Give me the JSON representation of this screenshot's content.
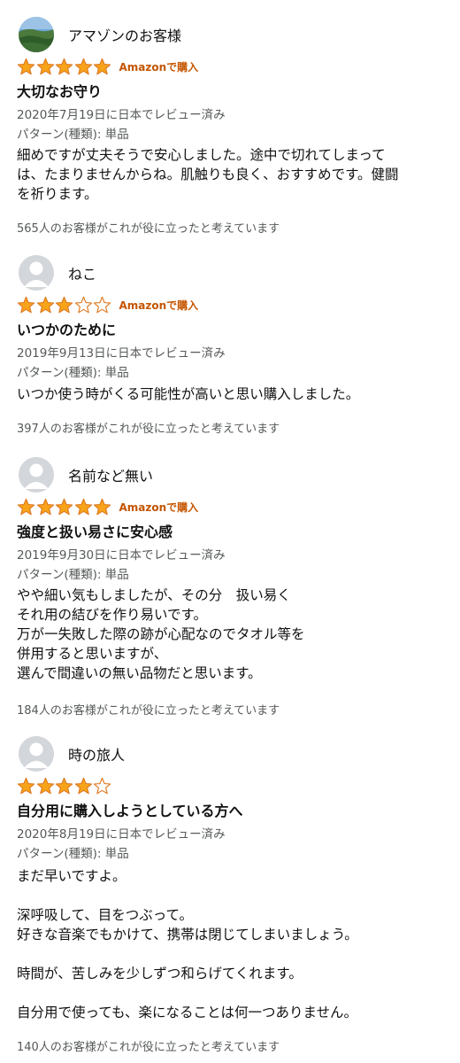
{
  "colors": {
    "star_fill": "#f8a41a",
    "star_outline": "#de7921",
    "badge": "#c45500",
    "meta": "#565959",
    "avatar_bg": "#d3d6da"
  },
  "reviews": [
    {
      "reviewer": "アマゾンのお客様",
      "avatar": "landscape-photo",
      "rating": 5,
      "max_rating": 5,
      "badge": "Amazonで購入",
      "title": "大切なお守り",
      "date_line": "2020年7月19日に日本でレビュー済み",
      "variant": "パターン(種類): 単品",
      "body": "細めですが丈夫そうで安心しました。途中で切れてしまって\nは、たまりませんからね。肌触りも良く、おすすめです。健闘\nを祈ります。",
      "helpful": "565人のお客様がこれが役に立ったと考えています"
    },
    {
      "reviewer": "ねこ",
      "avatar": "default-user",
      "rating": 3,
      "max_rating": 5,
      "badge": "Amazonで購入",
      "title": "いつかのために",
      "date_line": "2019年9月13日に日本でレビュー済み",
      "variant": "パターン(種類): 単品",
      "body": "いつか使う時がくる可能性が高いと思い購入しました。",
      "helpful": "397人のお客様がこれが役に立ったと考えています"
    },
    {
      "reviewer": "名前など無い",
      "avatar": "default-user",
      "rating": 5,
      "max_rating": 5,
      "badge": "Amazonで購入",
      "title": "強度と扱い易さに安心感",
      "date_line": "2019年9月30日に日本でレビュー済み",
      "variant": "パターン(種類): 単品",
      "body": "やや細い気もしましたが、その分　扱い易く\nそれ用の結びを作り易いです。\n万が一失敗した際の跡が心配なのでタオル等を\n併用すると思いますが、\n選んで間違いの無い品物だと思います。",
      "helpful": "184人のお客様がこれが役に立ったと考えています"
    },
    {
      "reviewer": "時の旅人",
      "avatar": "default-user",
      "rating": 4,
      "max_rating": 5,
      "badge": "",
      "title": "自分用に購入しようとしている方へ",
      "date_line": "2020年8月19日に日本でレビュー済み",
      "variant": "パターン(種類): 単品",
      "body": "まだ早いですよ。\n\n深呼吸して、目をつぶって。\n好きな音楽でもかけて、携帯は閉じてしまいましょう。\n\n時間が、苦しみを少しずつ和らげてくれます。\n\n自分用で使っても、楽になることは何一つありません。",
      "helpful": "140人のお客様がこれが役に立ったと考えています"
    }
  ]
}
